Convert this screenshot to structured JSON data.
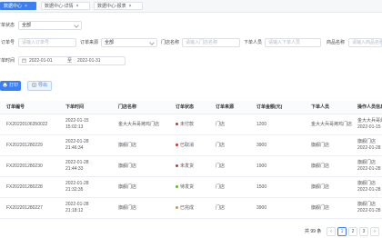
{
  "tabs": [
    {
      "label": "数据中心",
      "close": "×",
      "active": true
    },
    {
      "label": "数据中心-详情",
      "close": "×",
      "active": false
    },
    {
      "label": "数据中心-报表",
      "close": "×",
      "active": false
    }
  ],
  "filters": {
    "order_status": {
      "label": "订单状态",
      "value": "全部"
    },
    "order_no": {
      "label": "订单号",
      "placeholder": "请输入订单号"
    },
    "order_source": {
      "label": "订单来源",
      "value": "全部"
    },
    "store_name": {
      "label": "门店名称",
      "placeholder": "请输入门店名称"
    },
    "buyer": {
      "label": "下单人员",
      "placeholder": "请输入下单人员"
    },
    "product_name": {
      "label": "商品名称",
      "placeholder": "请输入商品名称"
    },
    "order_time": {
      "label": "下单时间",
      "start": "2022-01-01",
      "separator": "至",
      "end": "2022-01-31"
    }
  },
  "actions": {
    "print_label": "打印",
    "export_label": "导出"
  },
  "table": {
    "headers": [
      "订单编号",
      "下单时间",
      "门店名称",
      "订单状态",
      "订单来源",
      "订单金额(元)",
      "下单人员",
      "操作人员信息"
    ],
    "rows": [
      {
        "id": "FX20220106350022",
        "date": "2022-01-15",
        "time": "15:02:13",
        "store": "金大大兵哥烤鸡门店",
        "status": "未付款",
        "status_color": "#f5222d",
        "source": "门店",
        "amount": "1200",
        "buyer": "金大大兵哥烤鸡门店",
        "operator": "金大大兵哥烤鸡门店",
        "op_time": "2022-01-15"
      },
      {
        "id": "FX202201280229",
        "date": "2022-01-28",
        "time": "21:46:34",
        "store": "旗舰门店",
        "status": "已取消",
        "status_color": "#f5222d",
        "source": "门店",
        "amount": "3900",
        "buyer": "旗舰门店",
        "operator": "旗舰门店",
        "op_time": "2022-01-28"
      },
      {
        "id": "FX202201280230",
        "date": "2022-01-28",
        "time": "21:44:33",
        "store": "旗舰门店",
        "status": "未发货",
        "status_color": "#f5222d",
        "source": "门店",
        "amount": "1900",
        "buyer": "旗舰门店",
        "operator": "旗舰门店",
        "op_time": "2022-01-28"
      },
      {
        "id": "FX202201280228",
        "date": "2022-01-28",
        "time": "21:32:35",
        "store": "旗舰门店",
        "status": "待发货",
        "status_color": "#52c41a",
        "source": "门店",
        "amount": "1500",
        "buyer": "旗舰门店",
        "operator": "旗舰门店",
        "op_time": "2022-01-28"
      },
      {
        "id": "FX202201280227",
        "date": "2022-01-28",
        "time": "21:18:12",
        "store": "旗舰门店",
        "status": "已完成",
        "status_color": "#fa8c16",
        "source": "门店",
        "amount": "3900",
        "buyer": "旗舰门店",
        "operator": "旗舰门店",
        "op_time": "2022-01-28"
      }
    ]
  },
  "pagination": {
    "total_text": "共 99 条",
    "prev": "‹",
    "pages": [
      "1",
      "2",
      "3"
    ],
    "next": "›",
    "current": "1"
  },
  "colors": {
    "primary": "#3b7ff2",
    "border": "#dcdfe6"
  }
}
